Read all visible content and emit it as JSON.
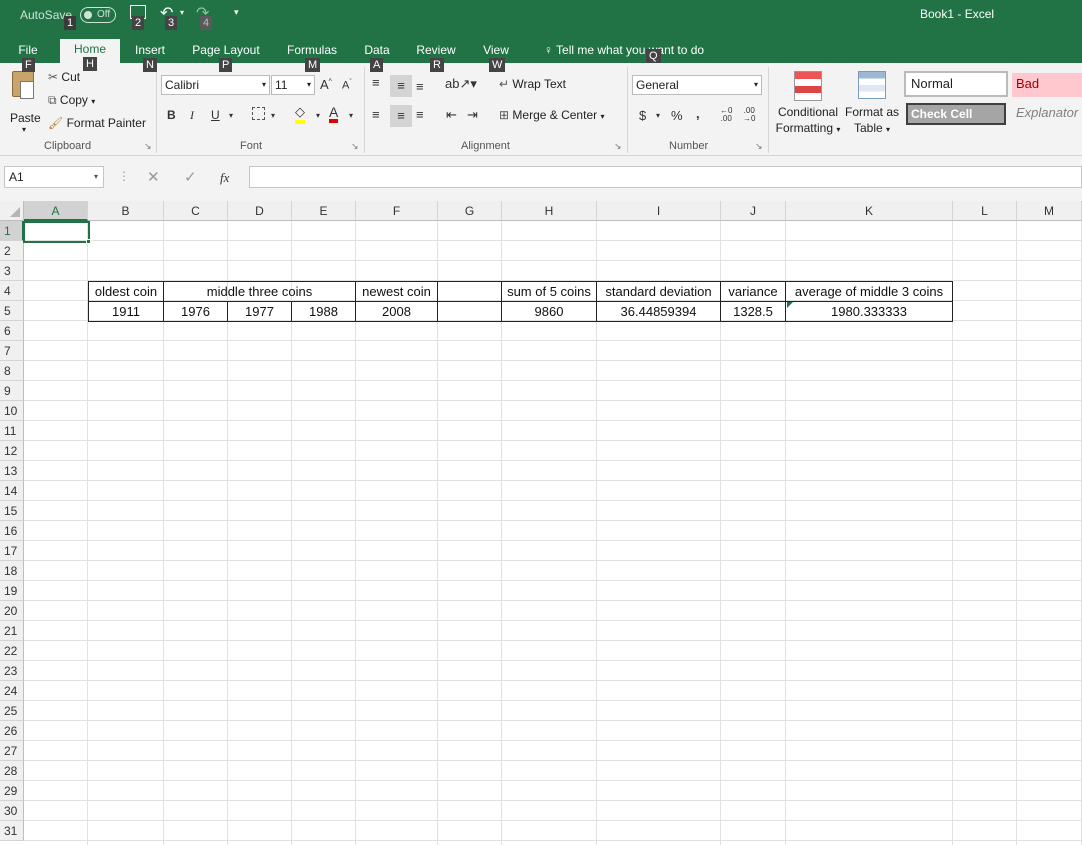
{
  "titlebar": {
    "autosave_label": "AutoSave",
    "autosave_state": "Off",
    "window_title": "Book1  -  Excel",
    "qat_keytips": [
      "1",
      "2",
      "3",
      "4"
    ]
  },
  "tabs": [
    {
      "label": "File",
      "key": "F"
    },
    {
      "label": "Home",
      "key": "H"
    },
    {
      "label": "Insert",
      "key": "N"
    },
    {
      "label": "Page Layout",
      "key": "P"
    },
    {
      "label": "Formulas",
      "key": "M"
    },
    {
      "label": "Data",
      "key": "A"
    },
    {
      "label": "Review",
      "key": "R"
    },
    {
      "label": "View",
      "key": "W"
    }
  ],
  "tell_me": {
    "label": "Tell me what you want to do",
    "key": "Q"
  },
  "ribbon": {
    "clipboard": {
      "group": "Clipboard",
      "paste": "Paste",
      "cut": "Cut",
      "copy": "Copy",
      "format_painter": "Format Painter"
    },
    "font": {
      "group": "Font",
      "name": "Calibri",
      "size": "11",
      "bold": "B",
      "italic": "I",
      "underline": "U"
    },
    "alignment": {
      "group": "Alignment",
      "wrap_text": "Wrap Text",
      "merge_center": "Merge & Center"
    },
    "number": {
      "group": "Number",
      "format": "General",
      "currency": "$",
      "percent": "%",
      "comma": ","
    },
    "styles": {
      "conditional_formatting_1": "Conditional",
      "conditional_formatting_2": "Formatting",
      "format_as_table_1": "Format as",
      "format_as_table_2": "Table",
      "normal": "Normal",
      "bad": "Bad",
      "check_cell": "Check Cell",
      "explanatory": "Explanator"
    }
  },
  "formula_bar": {
    "name_box": "A1",
    "fx": "fx",
    "content": ""
  },
  "columns": [
    "A",
    "B",
    "C",
    "D",
    "E",
    "F",
    "G",
    "H",
    "I",
    "J",
    "K",
    "L",
    "M"
  ],
  "rows": [
    "1",
    "2",
    "3",
    "4",
    "5",
    "6",
    "7",
    "8",
    "9",
    "10",
    "11",
    "12",
    "13",
    "14",
    "15",
    "16",
    "17",
    "18",
    "19",
    "20",
    "21",
    "22",
    "23",
    "24",
    "25",
    "26",
    "27",
    "28",
    "29",
    "30",
    "31"
  ],
  "sheet": {
    "row4": {
      "B": "oldest coin",
      "CDE": "middle three coins",
      "F": "newest coin",
      "H": "sum of 5 coins",
      "I": "standard deviation",
      "J": "variance",
      "K": "average of middle 3 coins"
    },
    "row5": {
      "B": "1911",
      "C": "1976",
      "D": "1977",
      "E": "1988",
      "F": "2008",
      "H": "9860",
      "I": "36.44859394",
      "J": "1328.5",
      "K": "1980.333333"
    }
  },
  "colors": {
    "accent": "#217346",
    "bad_bg": "#ffc7ce",
    "bad_text": "#9c0006",
    "check_bg": "#a5a5a5"
  }
}
